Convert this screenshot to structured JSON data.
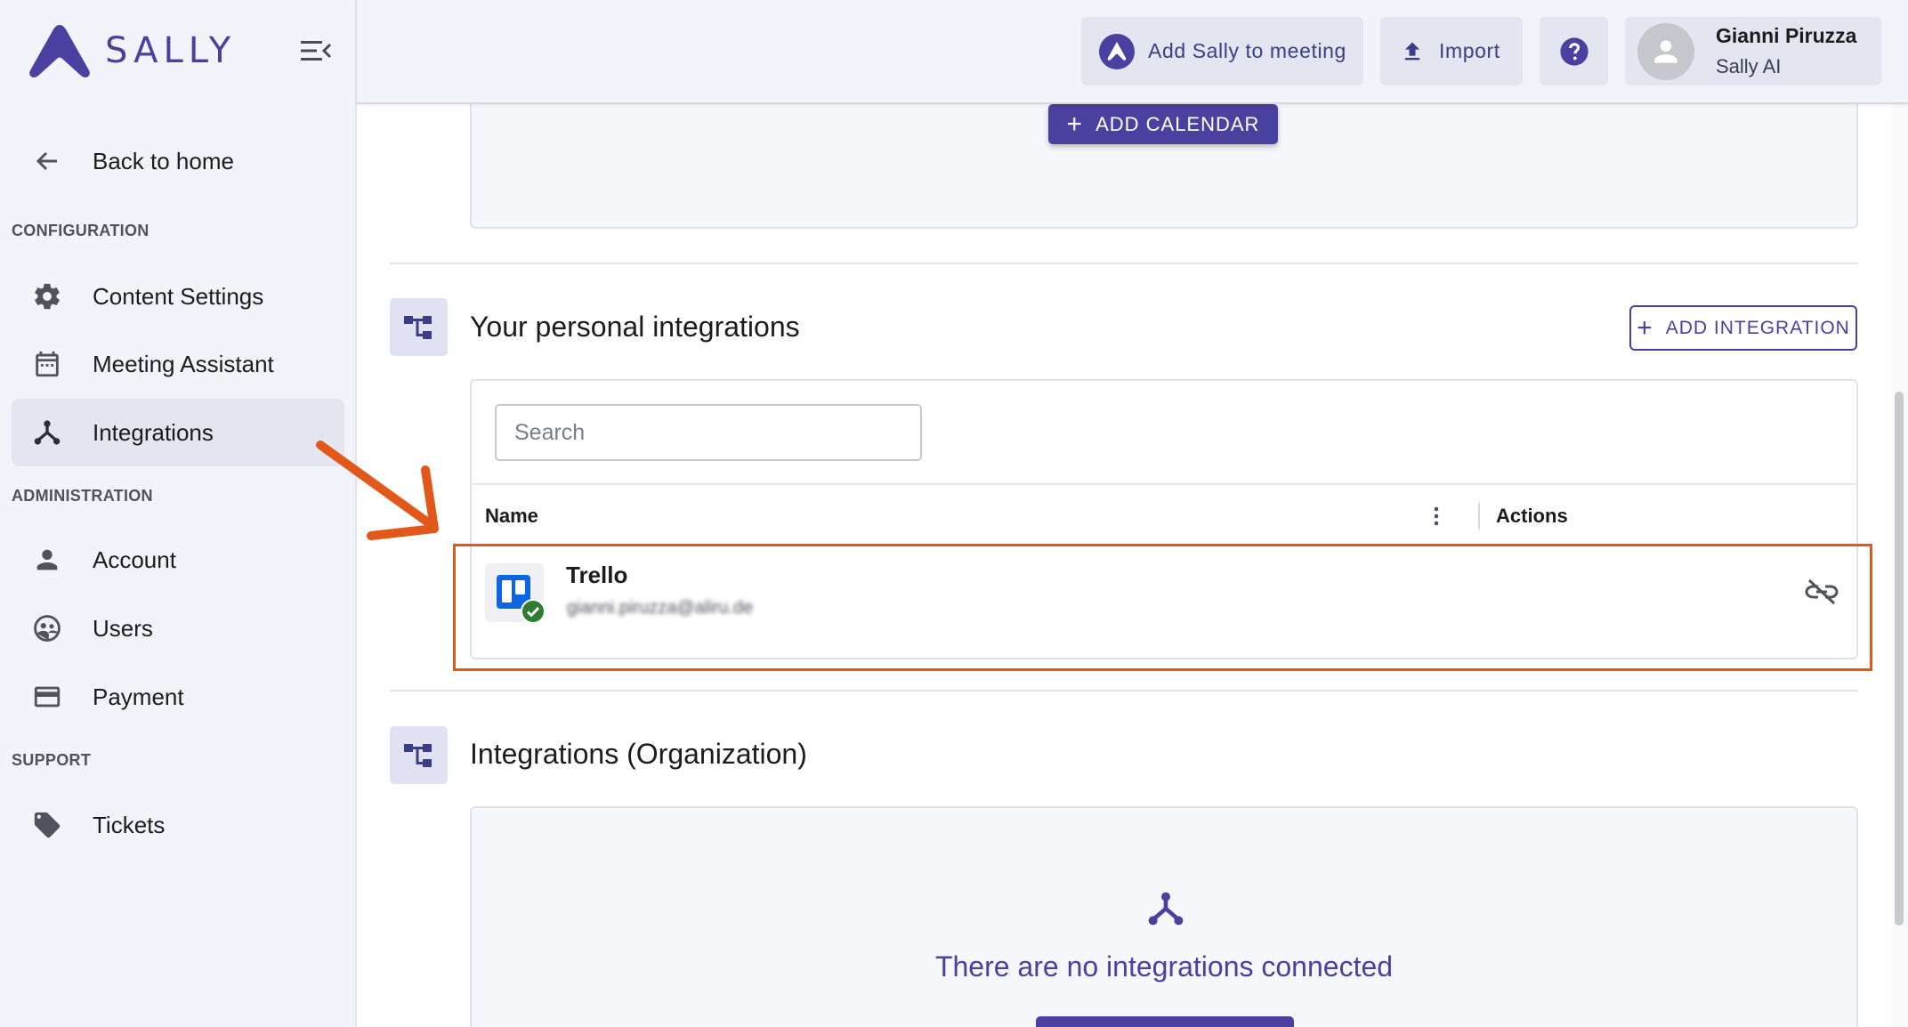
{
  "brand": {
    "name": "SALLY",
    "accent": "#4a40a0",
    "highlight": "#e2581b"
  },
  "sidebar": {
    "back": {
      "label": "Back to home",
      "icon": "arrow-left-icon"
    },
    "sections": [
      {
        "title": "CONFIGURATION"
      },
      {
        "title": "ADMINISTRATION"
      },
      {
        "title": "SUPPORT"
      }
    ],
    "items": [
      {
        "label": "Content Settings",
        "icon": "gear-icon"
      },
      {
        "label": "Meeting Assistant",
        "icon": "calendar-icon"
      },
      {
        "label": "Integrations",
        "icon": "integrations-icon",
        "active": true
      },
      {
        "label": "Account",
        "icon": "person-icon"
      },
      {
        "label": "Users",
        "icon": "users-icon"
      },
      {
        "label": "Payment",
        "icon": "credit-card-icon"
      },
      {
        "label": "Tickets",
        "icon": "tag-icon"
      }
    ]
  },
  "header": {
    "add_sally": "Add Sally to meeting",
    "import": "Import",
    "help_icon": "help-icon",
    "user": {
      "name": "Gianni Piruzza",
      "org": "Sally AI"
    }
  },
  "main": {
    "add_calendar": "ADD CALENDAR",
    "personal": {
      "title": "Your personal integrations",
      "add_button": "ADD INTEGRATION",
      "search_placeholder": "Search",
      "columns": {
        "name": "Name",
        "actions": "Actions"
      },
      "rows": [
        {
          "name": "Trello",
          "email": "gianni.piruzza@aliru.de",
          "status": "connected"
        }
      ]
    },
    "organization": {
      "title": "Integrations (Organization)",
      "empty": "There are no integrations connected"
    }
  }
}
